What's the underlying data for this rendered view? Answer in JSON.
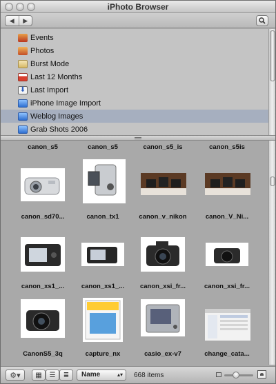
{
  "window": {
    "title": "iPhoto Browser"
  },
  "toolbar": {
    "back_icon": "◀",
    "forward_icon": "▶",
    "search_icon": "search-icon"
  },
  "sources": [
    {
      "label": "Events",
      "icon": "events-icon",
      "color": "#c0542a"
    },
    {
      "label": "Photos",
      "icon": "photos-icon",
      "color": "#d1642d"
    },
    {
      "label": "Burst Mode",
      "icon": "album-icon",
      "color": "#e3cf8e"
    },
    {
      "label": "Last 12 Months",
      "icon": "calendar-icon",
      "color": "#d9402f"
    },
    {
      "label": "Last Import",
      "icon": "import-icon",
      "color": "#3c6fcf"
    },
    {
      "label": "iPhone Image Import",
      "icon": "album-icon",
      "color": "#3f8ae3"
    },
    {
      "label": "Weblog Images",
      "icon": "album-icon",
      "color": "#3f8ae3",
      "selected": true
    },
    {
      "label": "Grab Shots 2006",
      "icon": "album-icon",
      "color": "#3f8ae3"
    }
  ],
  "photos": {
    "top_partial": [
      "canon_s5",
      "canon_s5",
      "canon_s5_is",
      "canon_s5is"
    ],
    "rows": [
      [
        "canon_sd70...",
        "canon_tx1",
        "canon_v_nikon",
        "canon_V_Ni..."
      ],
      [
        "canon_xs1_...",
        "canon_xs1_...",
        "canon_xsi_fr...",
        "canon_xsi_fr..."
      ],
      [
        "CanonS5_3q",
        "capture_nx",
        "casio_ex-v7",
        "change_cata..."
      ]
    ]
  },
  "bottombar": {
    "action_icon": "gear-icon",
    "sort_label": "Name",
    "count_label": "668 items"
  },
  "colors": {
    "selection": "#a6afbf",
    "grid_bg": "#a9a9a9",
    "source_bg": "#c4c4c4"
  }
}
